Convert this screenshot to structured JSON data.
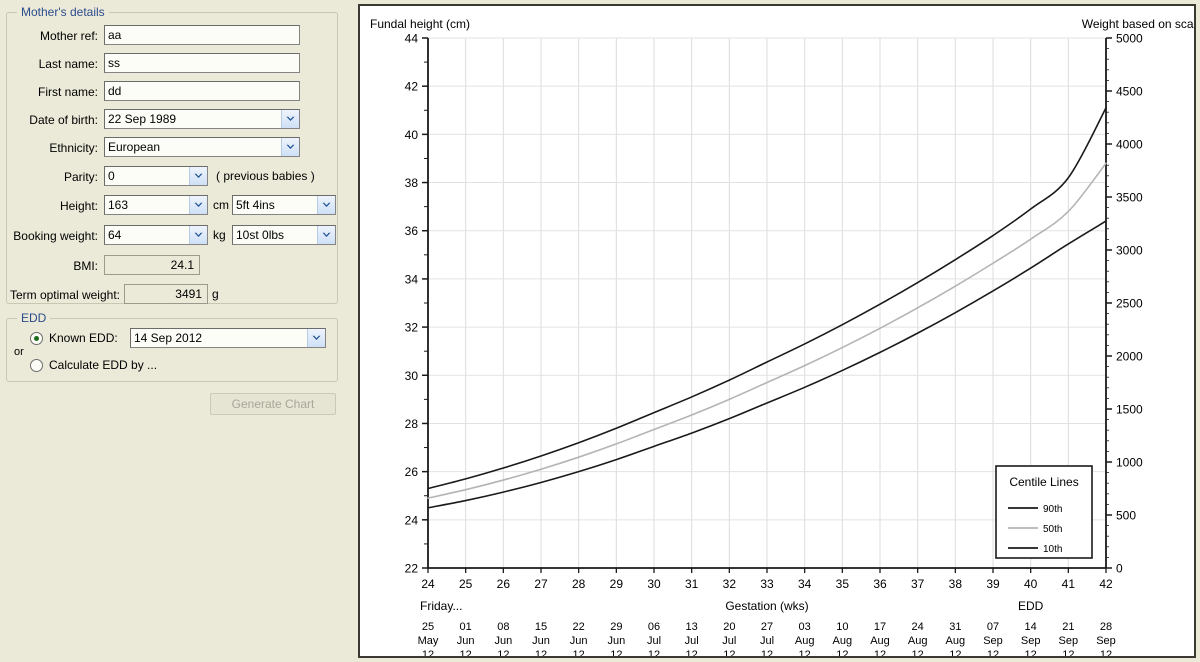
{
  "form": {
    "mother_group_title": "Mother's details",
    "fields": [
      {
        "label": "Mother ref:",
        "value": "aa",
        "type": "text"
      },
      {
        "label": "Last name:",
        "value": "ss",
        "type": "text"
      },
      {
        "label": "First name:",
        "value": "dd",
        "type": "text"
      },
      {
        "label": "Date of birth:",
        "value": "22 Sep 1989",
        "type": "combo"
      },
      {
        "label": "Ethnicity:",
        "value": "European",
        "type": "combo"
      },
      {
        "label": "Parity:",
        "value": "0",
        "type": "combo",
        "suffix": "( previous babies )"
      },
      {
        "label": "Height:",
        "value": "163",
        "type": "combo",
        "unit": "cm",
        "value2": "5ft 4ins"
      },
      {
        "label": "Booking weight:",
        "value": "64",
        "type": "combo",
        "unit": "kg",
        "value2": "10st 0lbs"
      },
      {
        "label": "BMI:",
        "value": "24.1",
        "type": "readonly"
      },
      {
        "label": "Term optimal weight:",
        "value": "3491",
        "type": "readonly",
        "unit": "g"
      }
    ],
    "edd_group_title": "EDD",
    "edd_or_label": "or",
    "known_edd_label": "Known EDD:",
    "known_edd_value": "14 Sep 2012",
    "known_edd_selected": true,
    "calculate_edd_label": "Calculate EDD by ...",
    "calculate_edd_selected": false,
    "generate_chart_label": "Generate Chart",
    "generate_chart_enabled": false
  },
  "chart_data": {
    "type": "line",
    "title": "",
    "left_axis_title": "Fundal height (cm)",
    "right_axis_title": "Weight based on scan (g)",
    "xlabel": "Gestation (wks)",
    "weekday_label": "Friday...",
    "edd_marker_label": "EDD",
    "edd_marker_week": 40,
    "grid": true,
    "ylim": [
      22,
      44
    ],
    "y_ticks": [
      22,
      24,
      26,
      28,
      30,
      32,
      34,
      36,
      38,
      40,
      42,
      44
    ],
    "y_minor_step": 1,
    "y2lim": [
      0,
      5000
    ],
    "y2_ticks": [
      0,
      500,
      1000,
      1500,
      2000,
      2500,
      3000,
      3500,
      4000,
      4500,
      5000
    ],
    "y2_minor_step": 100,
    "xlim": [
      24,
      42
    ],
    "x_ticks": [
      24,
      25,
      26,
      27,
      28,
      29,
      30,
      31,
      32,
      33,
      34,
      35,
      36,
      37,
      38,
      39,
      40,
      41,
      42
    ],
    "x_date_labels": [
      [
        "25",
        "May",
        "12"
      ],
      [
        "01",
        "Jun",
        "12"
      ],
      [
        "08",
        "Jun",
        "12"
      ],
      [
        "15",
        "Jun",
        "12"
      ],
      [
        "22",
        "Jun",
        "12"
      ],
      [
        "29",
        "Jun",
        "12"
      ],
      [
        "06",
        "Jul",
        "12"
      ],
      [
        "13",
        "Jul",
        "12"
      ],
      [
        "20",
        "Jul",
        "12"
      ],
      [
        "27",
        "Jul",
        "12"
      ],
      [
        "03",
        "Aug",
        "12"
      ],
      [
        "10",
        "Aug",
        "12"
      ],
      [
        "17",
        "Aug",
        "12"
      ],
      [
        "24",
        "Aug",
        "12"
      ],
      [
        "31",
        "Aug",
        "12"
      ],
      [
        "07",
        "Sep",
        "12"
      ],
      [
        "14",
        "Sep",
        "12"
      ],
      [
        "21",
        "Sep",
        "12"
      ],
      [
        "28",
        "Sep",
        "12"
      ]
    ],
    "legend": {
      "title": "Centile Lines",
      "position": "bottom-right",
      "entries": [
        {
          "name": "90th",
          "color": "#1a1a1a"
        },
        {
          "name": "50th",
          "color": "#b4b4b4"
        },
        {
          "name": "10th",
          "color": "#1a1a1a"
        }
      ]
    },
    "x": [
      24,
      25,
      26,
      27,
      28,
      29,
      30,
      31,
      32,
      33,
      34,
      35,
      36,
      37,
      38,
      39,
      40,
      41,
      42
    ],
    "series": [
      {
        "name": "90th",
        "color": "#1a1a1a",
        "width": 1.6,
        "values": [
          25.3,
          25.7,
          26.15,
          26.65,
          27.2,
          27.8,
          28.45,
          29.1,
          29.8,
          30.55,
          31.3,
          32.1,
          32.95,
          33.85,
          34.8,
          35.8,
          36.9,
          38.2,
          41.1
        ]
      },
      {
        "name": "50th",
        "color": "#b4b4b4",
        "width": 1.6,
        "values": [
          24.9,
          25.25,
          25.65,
          26.1,
          26.6,
          27.15,
          27.75,
          28.35,
          29.0,
          29.7,
          30.4,
          31.15,
          31.95,
          32.8,
          33.7,
          34.65,
          35.65,
          36.8,
          38.8
        ]
      },
      {
        "name": "10th",
        "color": "#1a1a1a",
        "width": 1.6,
        "values": [
          24.5,
          24.8,
          25.15,
          25.55,
          26.0,
          26.5,
          27.05,
          27.6,
          28.2,
          28.85,
          29.5,
          30.2,
          30.95,
          31.75,
          32.6,
          33.5,
          34.45,
          35.45,
          36.4
        ]
      }
    ]
  }
}
